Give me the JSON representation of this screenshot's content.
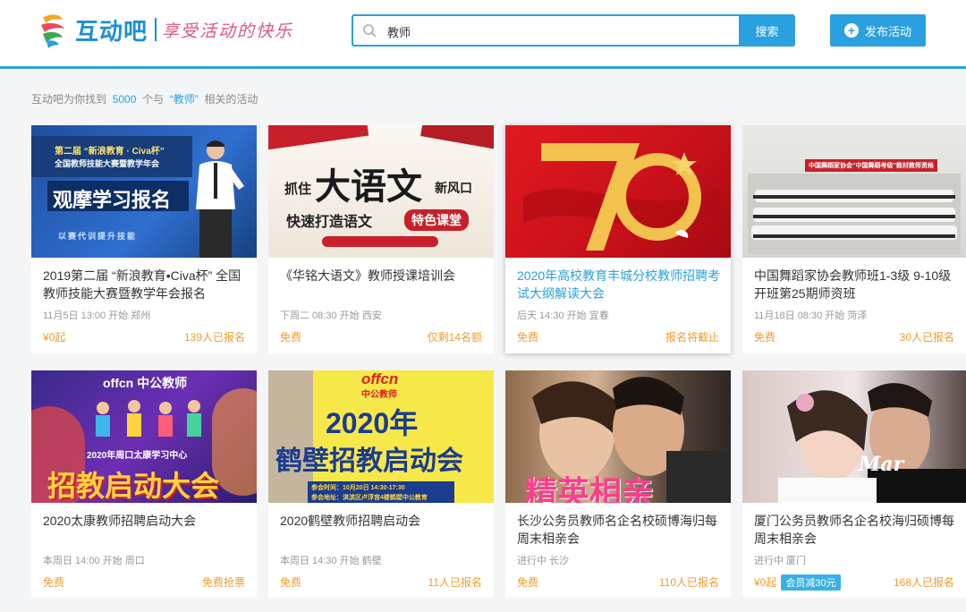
{
  "header": {
    "brand": "互动吧",
    "slogan": "享受活动的快乐",
    "search_value": "教师",
    "search_button": "搜索",
    "publish_button": "发布活动"
  },
  "result": {
    "prefix": "互动吧为你找到",
    "count": "5000",
    "middle": "个与",
    "keyword": "“教师”",
    "suffix": "相关的活动"
  },
  "cards": [
    {
      "title": "2019第二届 “新浪教育•Civa杯” 全国教师技能大赛暨教学年会报名",
      "meta": "11月5日 13:00 开始  郑州",
      "price": "¥0起",
      "stat": "139人已报名",
      "img": {
        "line1": "第二届 “新浪教育 · Civa杯”",
        "line2": "全国教师技能大赛暨教学年会",
        "main": "观摩学习报名",
        "sub": "以赛代训提升技能"
      }
    },
    {
      "title": "《华铭大语文》教师授课培训会",
      "meta": "下周二 08:30 开始  西安",
      "price": "免费",
      "stat": "仅剩14名额",
      "img": {
        "a": "抓住",
        "main": "大语文",
        "b": "新风口",
        "c": "快速打造语文",
        "tag": "特色课堂"
      }
    },
    {
      "title": "2020年高校教育丰城分校教师招聘考试大纲解读大会",
      "meta": "后天 14:30 开始  宜春",
      "price": "免费",
      "stat": "报名将截止",
      "img": {
        "main": "70"
      }
    },
    {
      "title": "中国舞蹈家协会教师班1-3级 9-10级开班第25期师资班",
      "meta": "11月18日 08:30 开始  菏泽",
      "price": "免费",
      "stat": "30人已报名",
      "img": {
        "banner": "中国舞蹈家协会“中国舞蹈考级”教材教师资格"
      }
    },
    {
      "title": "2020太康教师招聘启动大会",
      "meta": "本周日 14:00 开始  周口",
      "price": "免费",
      "stat": "免费抢票",
      "img": {
        "brand": "offcn 中公教师",
        "sub": "2020年周口太康学习中心",
        "main": "招教启动大会"
      }
    },
    {
      "title": "2020鹤壁教师招聘启动会",
      "meta": "本周日 14:30 开始  鹤壁",
      "price": "免费",
      "stat": "11人已报名",
      "img": {
        "brand": "offcn",
        "brand2": "中公教师",
        "year": "2020年",
        "main": "鹤壁招教启动会",
        "info1": "参会时间：10月20日 14:30-17:30",
        "info2": "参会地址：淇滨区卢浮宫4楼鹤壁中公教育"
      }
    },
    {
      "title": "长沙公务员教师名企名校硕博海归每周末相亲会",
      "meta": "进行中  长沙",
      "price": "免费",
      "stat": "110人已报名",
      "img": {
        "main": "精英相亲"
      }
    },
    {
      "title": "厦门公务员教师名企名校海归硕博每周末相亲会",
      "meta": "进行中  厦门",
      "price": "¥0起",
      "badge": "会员减30元",
      "stat": "168人已报名",
      "img": {
        "script": "Mar"
      }
    }
  ],
  "colors": {
    "accent": "#2aa0e0",
    "price": "#f39b2c",
    "active_title": "#2aa0e0"
  }
}
